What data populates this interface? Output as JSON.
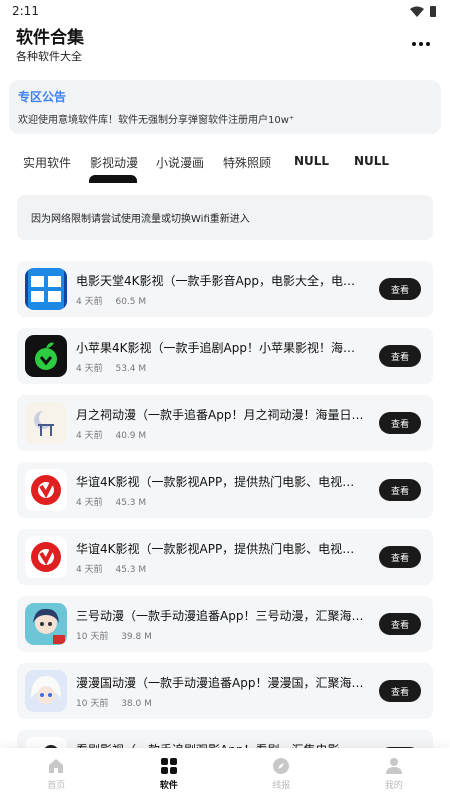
{
  "status": {
    "time": "2:11"
  },
  "header": {
    "title": "软件合集",
    "subtitle": "各种软件大全"
  },
  "notice": {
    "title": "专区公告",
    "text": "欢迎使用意境软件库！软件无强制分享弹窗软件注册用户10w⁺"
  },
  "tabs": [
    "实用软件",
    "影视动漫",
    "小说漫画",
    "特殊照顾",
    "NULL",
    "NULL"
  ],
  "active_tab": "影视动漫",
  "hint": "因为网络限制请尝试使用流量或切换Wifi重新进入",
  "view_label": "查看",
  "apps": [
    {
      "name": "电影天堂4K影视（一款手影音App，电影大全，电影，电视剧……",
      "time": "4 天前",
      "size": "60.5 M",
      "icon": "film-paradise-icon"
    },
    {
      "name": "小苹果4K影视（一款手追剧App！小苹果影视！海量电影……",
      "time": "4 天前",
      "size": "53.4 M",
      "icon": "green-apple-icon"
    },
    {
      "name": "月之祠动漫（一款手追番App！月之祠动漫！海量日漫……",
      "time": "4 天前",
      "size": "40.9 M",
      "icon": "moon-shrine-icon"
    },
    {
      "name": "华谊4K影视（一款影视APP，提供热门电影、电视剧、综艺……",
      "time": "4 天前",
      "size": "45.3 M",
      "icon": "huayi-red-icon"
    },
    {
      "name": "华谊4K影视（一款影视APP，提供热门电影、电视剧、综艺……",
      "time": "4 天前",
      "size": "45.3 M",
      "icon": "huayi-red-icon"
    },
    {
      "name": "三号动漫（一款手动漫追番App！三号动漫，汇聚海量动漫……",
      "time": "10 天前",
      "size": "39.8 M",
      "icon": "anime-girl-icon"
    },
    {
      "name": "漫漫国动漫（一款手动漫追番App！漫漫国，汇聚海量动漫……",
      "time": "10 天前",
      "size": "38.0 M",
      "icon": "white-hair-girl-icon"
    },
    {
      "name": "看剧影视（一款手追剧观影App！看剧，汇集电影、电视剧……",
      "time": "",
      "size": "",
      "icon": "dark-cloud-icon"
    }
  ],
  "nav": [
    {
      "label": "首页",
      "icon": "home-icon"
    },
    {
      "label": "软件",
      "icon": "grid-icon"
    },
    {
      "label": "线报",
      "icon": "compass-icon"
    },
    {
      "label": "我的",
      "icon": "person-icon"
    }
  ],
  "colors": {
    "accent": "#3b82f6",
    "button": "#1a1a1a",
    "card": "#f5f6f8"
  }
}
